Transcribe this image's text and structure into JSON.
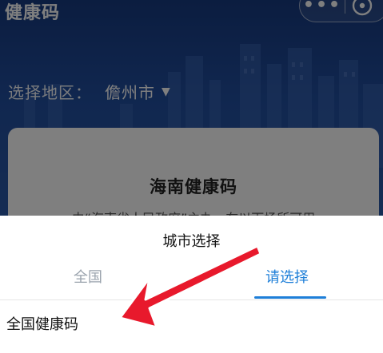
{
  "header": {
    "title": "健康码"
  },
  "capsule": {
    "more_icon": "more-dots-icon",
    "close_icon": "close-target-icon"
  },
  "region": {
    "label": "选择地区：",
    "value": "儋州市",
    "caret": "▼"
  },
  "card": {
    "title": "海南健康码",
    "description": "由“海南省人民政府”主办，在以下场所可用"
  },
  "sheet": {
    "title": "城市选择",
    "tabs": [
      {
        "label": "全国",
        "active": false
      },
      {
        "label": "请选择",
        "active": true
      }
    ],
    "items": [
      {
        "label": "全国健康码"
      }
    ]
  },
  "colors": {
    "header_blue": "#214e9f",
    "accent": "#1e7fd8",
    "arrow_red": "#e8192c"
  }
}
